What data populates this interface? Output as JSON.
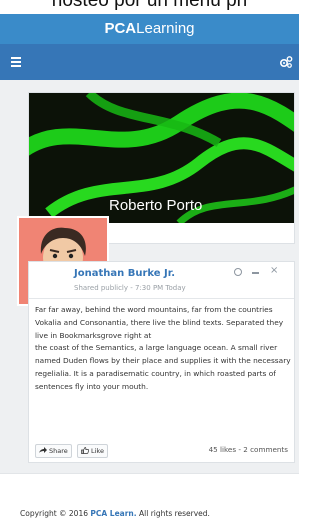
{
  "top_strip": {
    "text": "nosteo por un menu pri"
  },
  "appbar": {
    "brand_bold": "PCA",
    "brand_rest": "Learning"
  },
  "navbar": {
    "menu_icon": "menu-icon",
    "settings_icon": "gears-icon"
  },
  "profile": {
    "name": "Roberto Porto",
    "cover_color": "#1fd61a"
  },
  "post": {
    "author": "Jonathan Burke Jr.",
    "meta": "Shared publicly - 7:30 PM Today",
    "paragraphs": [
      "Far far away, behind the word mountains, far from the countries Vokalia and Consonantia, there live the blind texts. Separated they live in Bookmarksgrove right at",
      "the coast of the Semantics, a large language ocean. A small river named Duden flows by their place and supplies it with the necessary regelialia. It is a paradisematic country, in which roasted parts of sentences fly into your mouth."
    ],
    "share_label": "Share",
    "like_label": "Like",
    "stats": "45 likes - 2 comments",
    "close_glyph": "×"
  },
  "footer": {
    "prefix": "Copyright © 2016 ",
    "link": "PCA Learn.",
    "suffix": " All rights reserved."
  },
  "colors": {
    "appbar": "#3a8bc9",
    "navbar": "#3676b7",
    "link": "#3676b7"
  }
}
